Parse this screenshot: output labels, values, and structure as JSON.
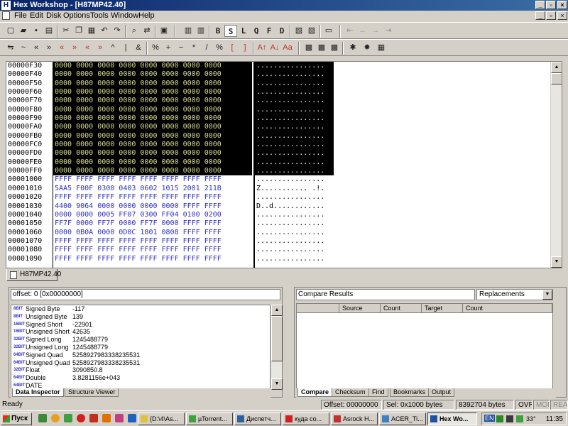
{
  "window": {
    "title": "Hex Workshop - [H87MP42.40]",
    "app_icon": "H"
  },
  "menu": [
    "File",
    "Edit",
    "Disk",
    "Options",
    "Tools",
    "Window",
    "Help"
  ],
  "toolbar_letters": [
    "B",
    "S",
    "L",
    "Q",
    "F",
    "D"
  ],
  "icons": {
    "toolbar1": [
      "new-icon",
      "open-icon",
      "save-icon",
      "print-icon",
      "cut-icon",
      "copy-icon",
      "paste-icon",
      "undo-icon",
      "redo-icon",
      "find-icon",
      "replace-icon",
      "goto-icon",
      "hex-16-icon",
      "hex-8-icon",
      "byte-order-icon",
      "window-icon",
      "first-icon",
      "back-icon",
      "forward-icon",
      "last-icon"
    ],
    "toolbar2": [
      "swap-icon",
      "not-icon",
      "shift-left-icon",
      "shift-right-icon",
      "rotate-left-icon",
      "rotate-right-icon",
      "block-left-icon",
      "block-right-icon",
      "xor-icon",
      "or-icon",
      "and-icon",
      "mod-icon",
      "add-icon",
      "subtract-icon",
      "multiply-icon",
      "divide-icon",
      "neg-icon",
      "upper-icon",
      "lower-icon",
      "compare-icon",
      "checksum-icon",
      "structure-icon",
      "tools-icon",
      "calculator-icon"
    ]
  },
  "hex": {
    "rows": [
      {
        "offset": "00000F30",
        "hex": "0000 0000 0000 0000 0000 0000 0000 0000",
        "ascii": "................",
        "selected": true
      },
      {
        "offset": "00000F40",
        "hex": "0000 0000 0000 0000 0000 0000 0000 0000",
        "ascii": "................",
        "selected": true
      },
      {
        "offset": "00000F50",
        "hex": "0000 0000 0000 0000 0000 0000 0000 0000",
        "ascii": "................",
        "selected": true
      },
      {
        "offset": "00000F60",
        "hex": "0000 0000 0000 0000 0000 0000 0000 0000",
        "ascii": "................",
        "selected": true
      },
      {
        "offset": "00000F70",
        "hex": "0000 0000 0000 0000 0000 0000 0000 0000",
        "ascii": "................",
        "selected": true
      },
      {
        "offset": "00000F80",
        "hex": "0000 0000 0000 0000 0000 0000 0000 0000",
        "ascii": "................",
        "selected": true
      },
      {
        "offset": "00000F90",
        "hex": "0000 0000 0000 0000 0000 0000 0000 0000",
        "ascii": "................",
        "selected": true
      },
      {
        "offset": "00000FA0",
        "hex": "0000 0000 0000 0000 0000 0000 0000 0000",
        "ascii": "................",
        "selected": true
      },
      {
        "offset": "00000FB0",
        "hex": "0000 0000 0000 0000 0000 0000 0000 0000",
        "ascii": "................",
        "selected": true
      },
      {
        "offset": "00000FC0",
        "hex": "0000 0000 0000 0000 0000 0000 0000 0000",
        "ascii": "................",
        "selected": true
      },
      {
        "offset": "00000FD0",
        "hex": "0000 0000 0000 0000 0000 0000 0000 0000",
        "ascii": "................",
        "selected": true
      },
      {
        "offset": "00000FE0",
        "hex": "0000 0000 0000 0000 0000 0000 0000 0000",
        "ascii": "................",
        "selected": true
      },
      {
        "offset": "00000FF0",
        "hex": "0000 0000 0000 0000 0000 0000 0000 0000",
        "ascii": "................",
        "selected": true
      },
      {
        "offset": "00001000",
        "hex": "FFFF FFFF FFFF FFFF FFFF FFFF FFFF FFFF",
        "ascii": "................",
        "selected": false
      },
      {
        "offset": "00001010",
        "hex": "5AA5 F00F 0300 0403 0602 1015 2001 211B",
        "ascii": "Z........... .!.",
        "selected": false
      },
      {
        "offset": "00001020",
        "hex": "FFFF FFFF FFFF FFFF FFFF FFFF FFFF FFFF",
        "ascii": "................",
        "selected": false
      },
      {
        "offset": "00001030",
        "hex": "4400 9064 0000 0000 0000 0000 FFFF FFFF",
        "ascii": "D..d............",
        "selected": false
      },
      {
        "offset": "00001040",
        "hex": "0000 0000 0005 FF07 0300 FF04 0100 0200",
        "ascii": "................",
        "selected": false
      },
      {
        "offset": "00001050",
        "hex": "FF7F 0000 FF7F 0000 FF7F 0000 FFFF FFFF",
        "ascii": "................",
        "selected": false
      },
      {
        "offset": "00001060",
        "hex": "0000 0B0A 0000 0D0C 1801 0808 FFFF FFFF",
        "ascii": "................",
        "selected": false
      },
      {
        "offset": "00001070",
        "hex": "FFFF FFFF FFFF FFFF FFFF FFFF FFFF FFFF",
        "ascii": "................",
        "selected": false
      },
      {
        "offset": "00001080",
        "hex": "FFFF FFFF FFFF FFFF FFFF FFFF FFFF FFFF",
        "ascii": "................",
        "selected": false
      },
      {
        "offset": "00001090",
        "hex": "FFFF FFFF FFFF FFFF FFFF FFFF FFFF FFFF",
        "ascii": "................",
        "selected": false
      }
    ]
  },
  "doc_tab": "H87MP42.40",
  "inspector": {
    "offset_label": "offset: 0 [0x00000000]",
    "rows": [
      {
        "bits": "8BIT",
        "name": "Signed Byte",
        "value": "-117"
      },
      {
        "bits": "8BIT",
        "name": "Unsigned Byte",
        "value": "139"
      },
      {
        "bits": "16BIT",
        "name": "Signed Short",
        "value": "-22901"
      },
      {
        "bits": "16BIT",
        "name": "Unsigned Short",
        "value": "42635"
      },
      {
        "bits": "32BIT",
        "name": "Signed Long",
        "value": "1245488779"
      },
      {
        "bits": "32BIT",
        "name": "Unsigned Long",
        "value": "1245488779"
      },
      {
        "bits": "64BIT",
        "name": "Signed Quad",
        "value": "5258927983338235531"
      },
      {
        "bits": "64BIT",
        "name": "Unsigned Quad",
        "value": "5258927983338235531"
      },
      {
        "bits": "32BIT",
        "name": "Float",
        "value": "3090850.8"
      },
      {
        "bits": "64BIT",
        "name": "Double",
        "value": "3.8281156e+043"
      },
      {
        "bits": "64BIT",
        "name": "DATE",
        "value": ""
      }
    ],
    "tabs": [
      "Data Inspector",
      "Structure Viewer"
    ]
  },
  "compare": {
    "title": "Compare Results",
    "mode": "Replacements",
    "columns": [
      "",
      "Source",
      "Count",
      "Target",
      "Count"
    ],
    "tabs": [
      "Compare",
      "Checksum",
      "Find",
      "Bookmarks",
      "Output"
    ]
  },
  "status": {
    "ready": "Ready",
    "offset": "Offset: 00000000",
    "sel": "Sel: 0x1000 bytes",
    "size": "8392704 bytes",
    "ovr": "OVR",
    "mod": "MOD",
    "read": "READ"
  },
  "taskbar": {
    "start": "Пуск",
    "tasks": [
      {
        "label": "{D:\\4\\As...",
        "active": false
      },
      {
        "label": "µTorrent...",
        "active": false
      },
      {
        "label": "Диспетч...",
        "active": false
      },
      {
        "label": "куда со...",
        "active": false
      },
      {
        "label": "Asrock H...",
        "active": false
      },
      {
        "label": "ACER_Ti...",
        "active": false
      },
      {
        "label": "Hex Wo...",
        "active": true
      }
    ],
    "tray_lang": "EN",
    "tray_temp": "33°",
    "clock": "11:35"
  },
  "colors": {
    "title_gradient_start": "#0a246a",
    "hex_selected_bg": "#000000",
    "hex_selected_text": "#d8d890",
    "hex_normal_text": "#3030c0"
  }
}
